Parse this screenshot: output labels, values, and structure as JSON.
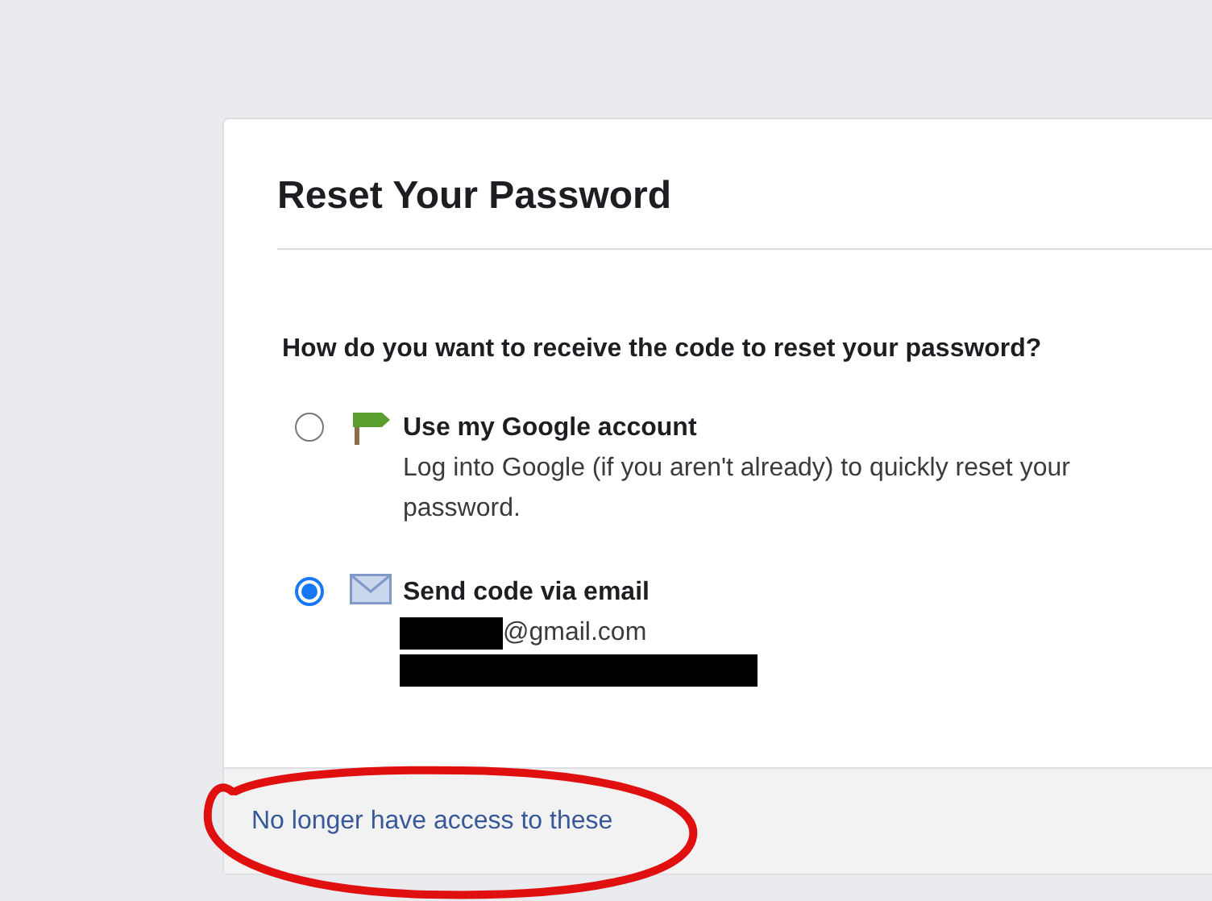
{
  "dialog": {
    "title": "Reset Your Password",
    "question": "How do you want to receive the code to reset your password?",
    "options": [
      {
        "kind": "google",
        "title": "Use my Google account",
        "description": "Log into Google (if you aren't already) to quickly reset your password.",
        "selected": false
      },
      {
        "kind": "email",
        "title": "Send code via email",
        "detail": "@gmail.com",
        "selected": true
      }
    ],
    "footer_link": "No longer have access to these"
  }
}
